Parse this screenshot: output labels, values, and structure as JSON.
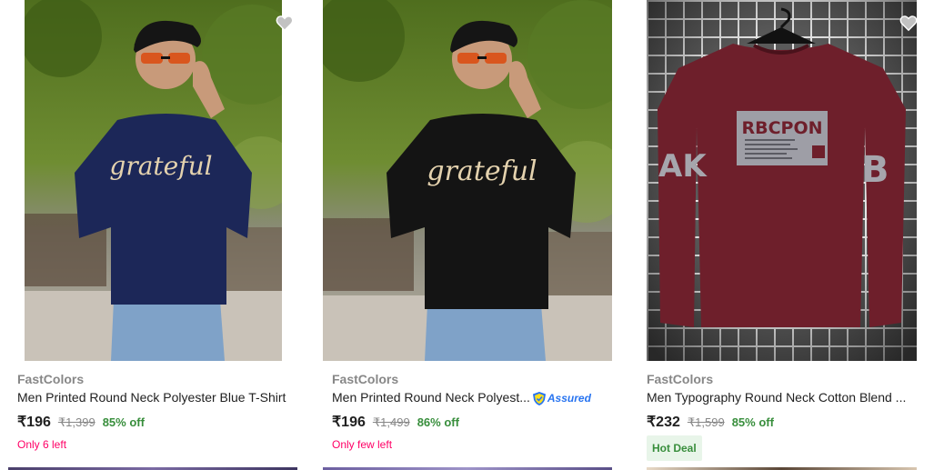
{
  "products": [
    {
      "brand": "FastColors",
      "title": "Men Printed Round Neck Polyester Blue T-Shirt",
      "price": "₹196",
      "mrp": "₹1,399",
      "discount": "85% off",
      "status": "Only 6 left",
      "image_text": "grateful",
      "tshirt_color": "#1c2758",
      "wishlist_icon": "heart-icon"
    },
    {
      "brand": "FastColors",
      "title": "Men Printed Round Neck Polyest...",
      "assured_label": "Assured",
      "price": "₹196",
      "mrp": "₹1,499",
      "discount": "86% off",
      "status": "Only few left",
      "image_text": "grateful",
      "tshirt_color": "#141414"
    },
    {
      "brand": "FastColors",
      "title": "Men Typography Round Neck Cotton Blend ...",
      "price": "₹232",
      "mrp": "₹1,599",
      "discount": "85% off",
      "badge": "Hot Deal",
      "image_text": "RBCPON",
      "sleeve_left": "AK",
      "sleeve_right": "B",
      "tshirt_color": "#6e1f2b",
      "wishlist_icon": "heart-icon"
    }
  ],
  "colors": {
    "brand_grey": "#878787",
    "discount_green": "#388e3c",
    "stock_pink": "#ff0066",
    "assured_blue": "#2874f0"
  }
}
